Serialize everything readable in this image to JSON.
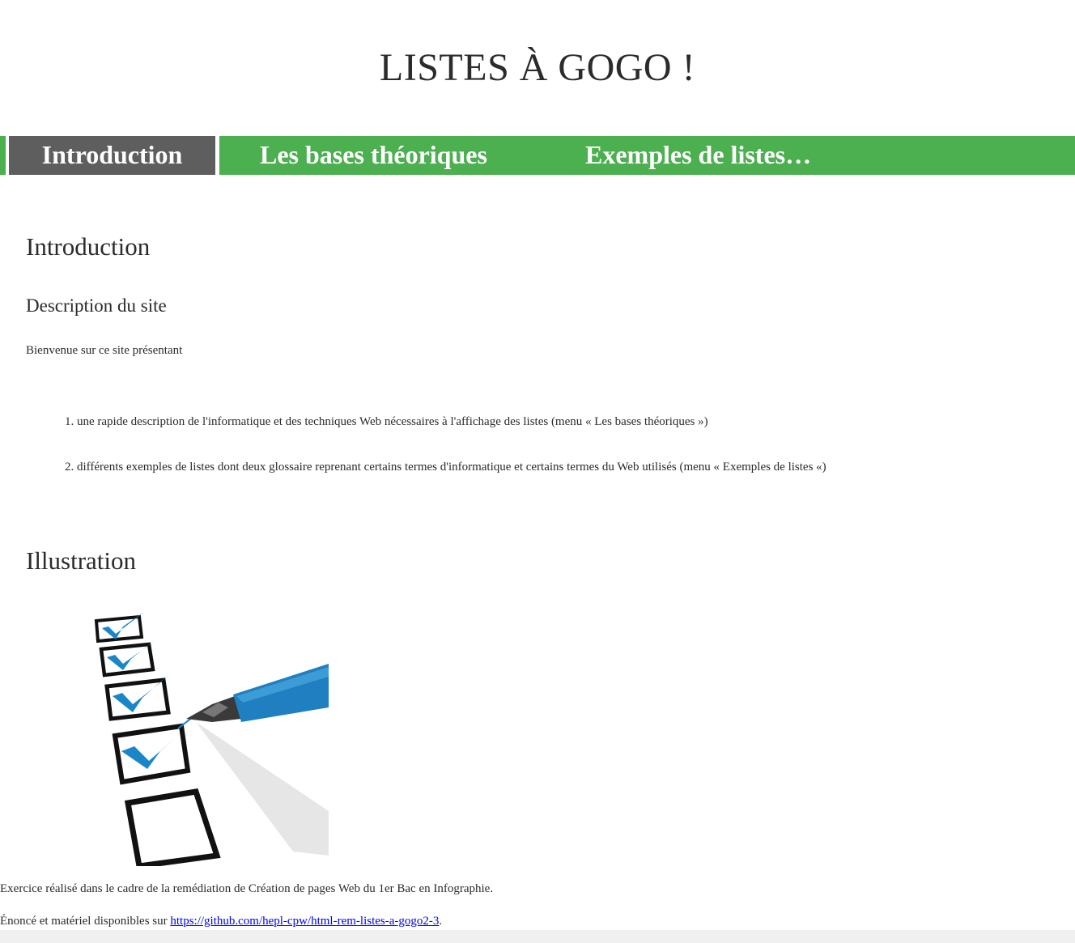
{
  "header": {
    "title": "LISTES À GOGO !"
  },
  "nav": {
    "items": [
      {
        "label": "Introduction",
        "active": true
      },
      {
        "label": "Les bases théoriques",
        "active": false
      },
      {
        "label": "Exemples de listes…",
        "active": false
      }
    ]
  },
  "main": {
    "heading": "Introduction",
    "subheading": "Description du site",
    "intro_text": "Bienvenue sur ce site présentant",
    "list": [
      {
        "number": "1.",
        "text": "une rapide description de l'informatique et des techniques Web nécessaires à l'affichage des listes (menu « Les bases théoriques »)"
      },
      {
        "number": "2.",
        "text": "différents exemples de listes dont deux glossaire reprenant certains termes d'informatique et certains termes du Web utilisés (menu « Exemples de listes «)"
      }
    ],
    "illustration_heading": "Illustration",
    "illustration_icon": "checklist-pen-image"
  },
  "footer": {
    "credit": "Exercice réalisé dans le cadre de la remédiation de Création de pages Web du 1er Bac en Infographie.",
    "source_prefix": "Énoncé et matériel disponibles sur ",
    "source_link": "https://github.com/hepl-cpw/html-rem-listes-a-gogo2-3",
    "source_suffix": "."
  },
  "colors": {
    "nav_background": "#4caf50",
    "nav_active": "#5e5e5e",
    "text": "#2b2b2b",
    "check_blue": "#1a86c8",
    "pen_blue": "#1f7fc0"
  }
}
